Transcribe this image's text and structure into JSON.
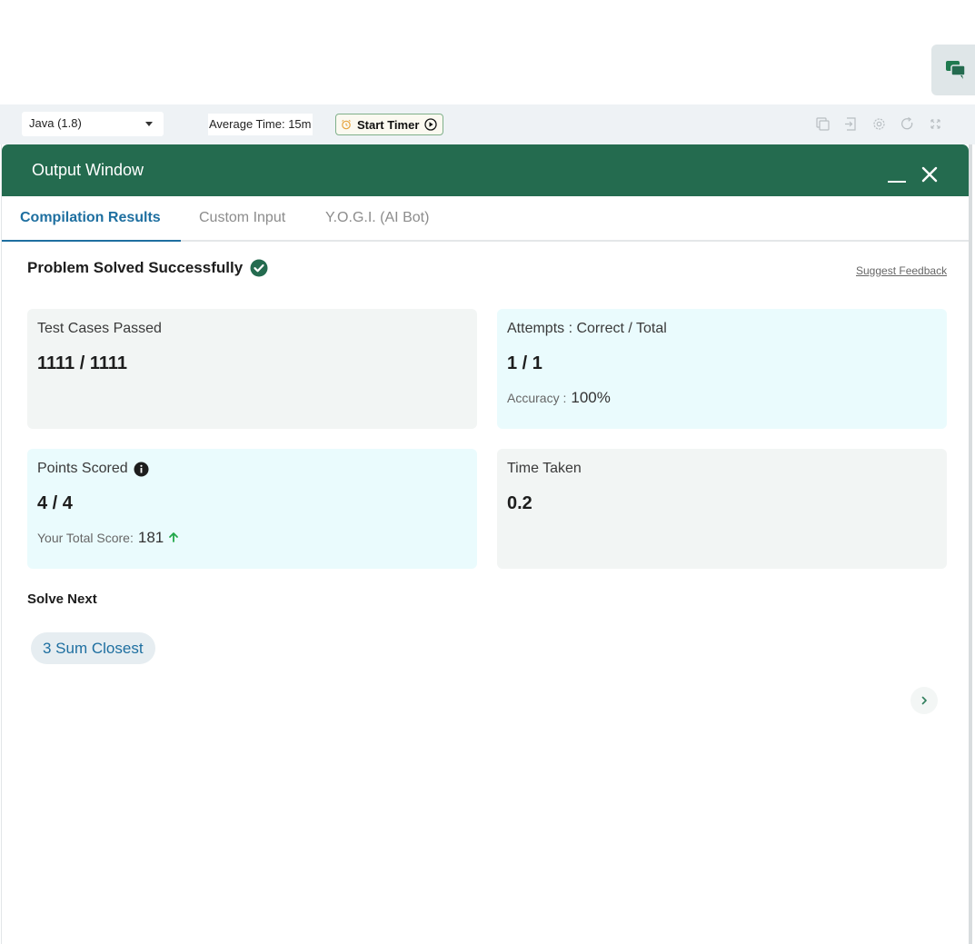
{
  "toolbar": {
    "language": "Java (1.8)",
    "average_time": "Average Time: 15m",
    "start_timer": "Start Timer"
  },
  "output_window": {
    "title": "Output Window",
    "tabs": [
      {
        "label": "Compilation Results",
        "active": true
      },
      {
        "label": "Custom Input",
        "active": false
      },
      {
        "label": "Y.O.G.I. (AI Bot)",
        "active": false
      }
    ],
    "status": "Problem Solved Successfully",
    "feedback_link": "Suggest Feedback",
    "cards": {
      "test_cases": {
        "label": "Test Cases Passed",
        "value": "1111 / 1111"
      },
      "attempts": {
        "label": "Attempts : Correct / Total",
        "value": "1 / 1",
        "sub_label": "Accuracy :",
        "sub_value": "100%"
      },
      "points": {
        "label": "Points Scored",
        "value": "4 / 4",
        "sub_label": "Your Total Score:",
        "sub_value": "181"
      },
      "time": {
        "label": "Time Taken",
        "value": "0.2"
      }
    },
    "solve_next": {
      "heading": "Solve Next",
      "items": [
        "3 Sum Closest"
      ]
    }
  },
  "colors": {
    "header_green": "#246b4f",
    "tab_active_blue": "#1e6fa0",
    "success_green": "#246b4f",
    "score_up_green": "#22a84a",
    "card_grey": "#f2f5f4",
    "card_blue": "#eafbfd"
  },
  "icons": [
    "chat-icon",
    "alarm-icon",
    "play-circle-icon",
    "copy-icon",
    "login-icon",
    "settings-icon",
    "refresh-icon",
    "fullscreen-icon",
    "minimize-icon",
    "close-icon",
    "check-circle-icon",
    "info-icon",
    "arrow-up-icon",
    "chevron-right-icon"
  ]
}
